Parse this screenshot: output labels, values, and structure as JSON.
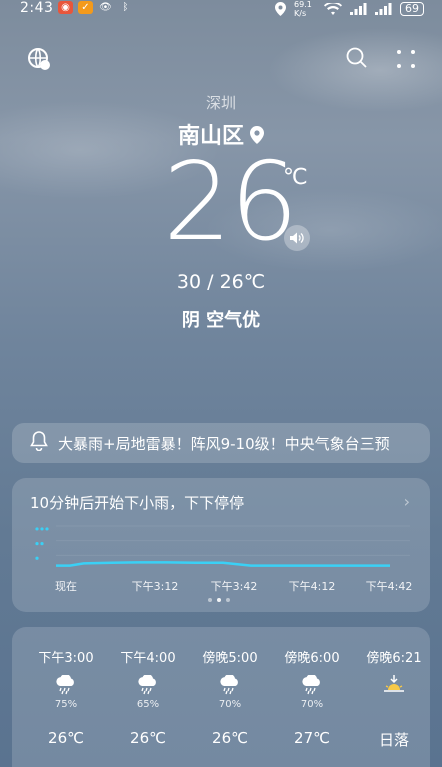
{
  "status_bar": {
    "time": "2:43",
    "network_speed": "69.1 K/s",
    "battery": "69"
  },
  "location": {
    "city": "深圳",
    "district": "南山区"
  },
  "current": {
    "temperature": "26",
    "unit": "℃",
    "range": "30 / 26℃",
    "condition": "阴  空气优"
  },
  "alert": {
    "text": "大暴雨+局地雷暴！阵风9-10级！中央气象台三预"
  },
  "precipitation": {
    "title": "10分钟后开始下小雨，下下停停",
    "labels": [
      "现在",
      "下午3:12",
      "下午3:42",
      "下午4:12",
      "下午4:42"
    ],
    "chart_data": {
      "type": "area",
      "x": [
        0,
        5,
        10,
        20,
        30,
        40,
        50,
        60,
        70,
        80,
        90,
        100,
        110,
        120
      ],
      "values": [
        0.3,
        0.3,
        0.45,
        0.5,
        0.52,
        0.52,
        0.5,
        0.5,
        0.3,
        0.3,
        0.3,
        0.3,
        0.3,
        0.3
      ],
      "ylim": [
        0,
        3
      ]
    },
    "page_dots": 3,
    "active_dot": 1
  },
  "hourly": [
    {
      "time": "下午3:00",
      "icon": "rain-cloud-icon",
      "pct": "75%",
      "temp": "26℃"
    },
    {
      "time": "下午4:00",
      "icon": "rain-cloud-icon",
      "pct": "65%",
      "temp": "26℃"
    },
    {
      "time": "傍晚5:00",
      "icon": "rain-cloud-icon",
      "pct": "70%",
      "temp": "26℃"
    },
    {
      "time": "傍晚6:00",
      "icon": "rain-cloud-icon",
      "pct": "70%",
      "temp": "27℃"
    },
    {
      "time": "傍晚6:21",
      "icon": "sunset-icon",
      "pct": "",
      "temp": "日落"
    }
  ],
  "colors": {
    "precip_line": "#3ad0f5"
  }
}
